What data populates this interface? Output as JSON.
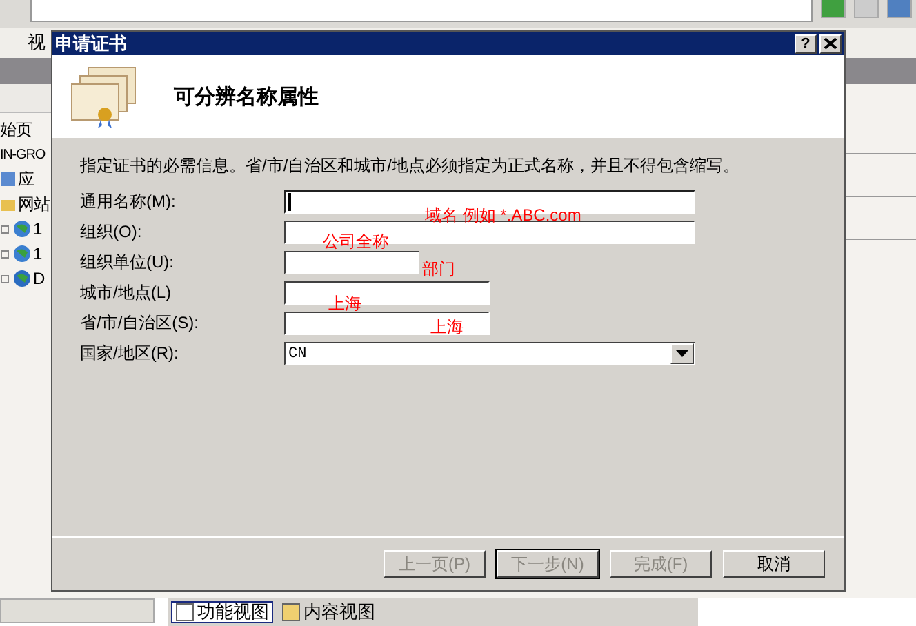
{
  "background_window": {
    "menu": [
      "视"
    ],
    "tree": [
      {
        "label": "始页",
        "kind": "plain"
      },
      {
        "label": "IN-GRO",
        "kind": "plain"
      },
      {
        "label": "应",
        "kind": "app"
      },
      {
        "label": "网站",
        "kind": "folder"
      },
      {
        "label": "1",
        "kind": "globe"
      },
      {
        "label": "1",
        "kind": "globe"
      },
      {
        "label": "D",
        "kind": "globe-help"
      }
    ],
    "view_tabs": [
      {
        "label": "功能视图",
        "selected": true
      },
      {
        "label": "内容视图",
        "selected": false
      }
    ]
  },
  "dialog": {
    "title": "申请证书",
    "help": "?",
    "header": "可分辨名称属性",
    "instructions": "指定证书的必需信息。省/市/自治区和城市/地点必须指定为正式名称，并且不得包含缩写。",
    "fields": [
      {
        "label": "通用名称(M):",
        "kind": "wide",
        "focused": true
      },
      {
        "label": "组织(O):",
        "kind": "wide",
        "focused": false
      },
      {
        "label": "组织单位(U):",
        "kind": "narrow",
        "focused": false
      },
      {
        "label": "城市/地点(L)",
        "kind": "medium",
        "focused": false
      },
      {
        "label": "省/市/自治区(S):",
        "kind": "medium",
        "focused": false
      },
      {
        "label": "国家/地区(R):",
        "kind": "dropdown",
        "value": "CN",
        "focused": false
      }
    ],
    "annotations": [
      "域名 例如 *.ABC.com",
      "公司全称",
      "部门",
      "上海",
      "上海"
    ],
    "buttons": [
      {
        "label": "上一页(P)",
        "disabled": true,
        "default": false
      },
      {
        "label": "下一步(N)",
        "disabled": true,
        "default": true
      },
      {
        "label": "完成(F)",
        "disabled": true,
        "default": false
      },
      {
        "label": "取消",
        "disabled": false,
        "default": false
      }
    ]
  }
}
